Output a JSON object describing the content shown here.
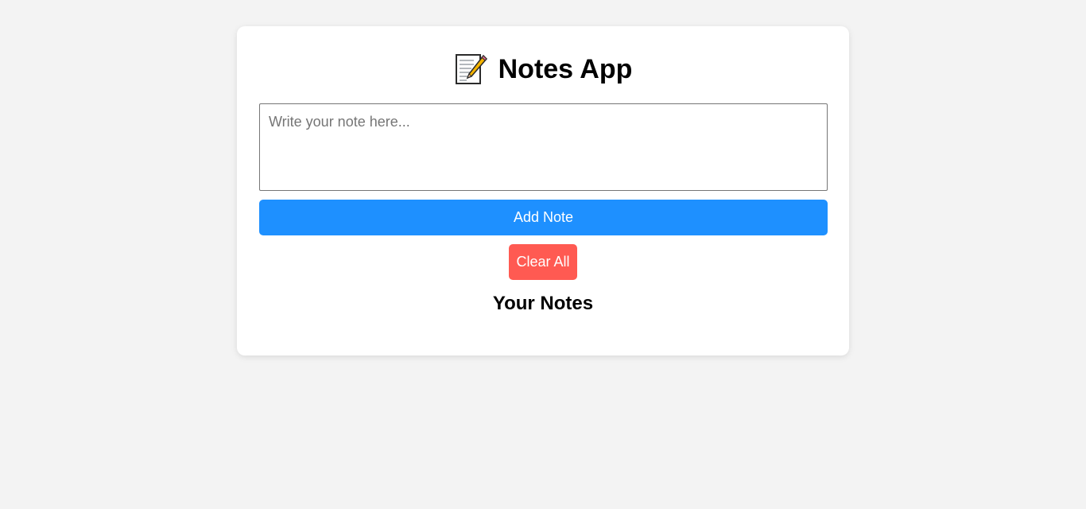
{
  "app": {
    "title": "Notes App",
    "title_icon": "memo-icon"
  },
  "editor": {
    "placeholder": "Write your note here...",
    "value": ""
  },
  "actions": {
    "add_label": "Add Note",
    "clear_label": "Clear All"
  },
  "notes_section": {
    "heading": "Your Notes",
    "notes": []
  },
  "colors": {
    "background": "#f3f3f3",
    "card": "#ffffff",
    "add_button": "#1e90ff",
    "clear_button": "#ff5a52"
  }
}
